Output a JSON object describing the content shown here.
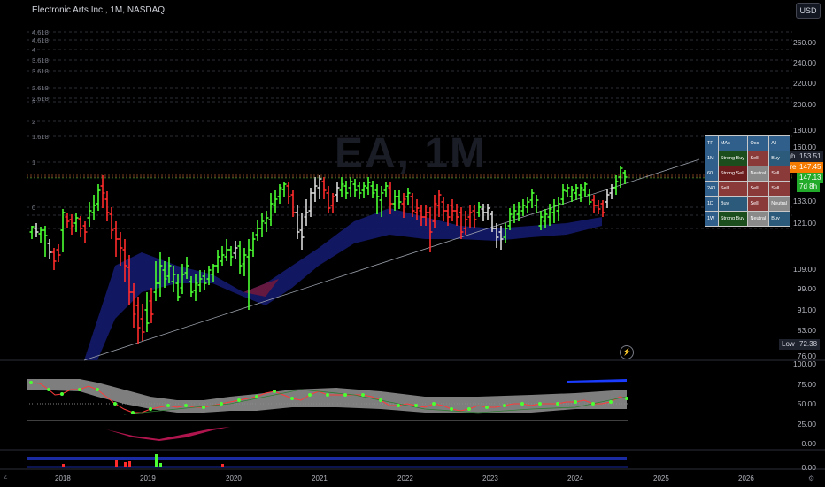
{
  "header": {
    "title": "Electronic Arts Inc., 1M, NASDAQ",
    "currency_button": "USD"
  },
  "watermark": "EA, 1M",
  "price_axis": [
    "260.00",
    "240.00",
    "220.00",
    "200.00",
    "180.00",
    "160.00",
    "147.45",
    "133.00",
    "121.00",
    "109.00",
    "99.00",
    "91.00",
    "83.00",
    "76.00"
  ],
  "osc_axis": [
    "100.00",
    "75.00",
    "50.00",
    "25.00",
    "0.00"
  ],
  "vol_axis": [
    "0.00"
  ],
  "time_axis": [
    "2018",
    "2019",
    "2020",
    "2021",
    "2022",
    "2023",
    "2024",
    "2025",
    "2026"
  ],
  "fib_labels": [
    "4.618",
    "4.618",
    "4",
    "3.618",
    "3.618",
    "2.618",
    "2.618",
    "3",
    "2",
    "1.618",
    "1",
    "0"
  ],
  "price_tags": {
    "high_label": "High",
    "high_value": "153.51",
    "pre_label": "Pre",
    "pre_value": "147.45",
    "last_value": "147.13",
    "countdown": "7d 8h",
    "low_label": "Low",
    "low_value": "72.38"
  },
  "ta_table": {
    "headers": [
      "TF",
      "MAs",
      "Osc",
      "All"
    ],
    "rows": [
      {
        "tf": "1M",
        "mas": "Strong Buy",
        "osc": "Sell",
        "all": "Buy"
      },
      {
        "tf": "60",
        "mas": "Strong Sell",
        "osc": "Neutral",
        "all": "Sell"
      },
      {
        "tf": "240",
        "mas": "Sell",
        "osc": "Sell",
        "all": "Sell"
      },
      {
        "tf": "1D",
        "mas": "Buy",
        "osc": "Sell",
        "all": "Neutral"
      },
      {
        "tf": "1W",
        "mas": "Strong Buy",
        "osc": "Neutral",
        "all": "Buy"
      }
    ]
  },
  "icons": {
    "timezone": "Z",
    "settings": "⚙",
    "bolt": "⚡"
  },
  "colors": {
    "up_bar": "#4cff33",
    "down_bar": "#ff2b2b",
    "neutral_bar": "#d9d9d9",
    "cloud": "#141a6b",
    "table_strong_buy": "#1c4d1c",
    "table_sell": "#8b3a3a",
    "table_neutral": "#8a8a8a",
    "table_buy": "#2b5a7a",
    "table_header": "#2f5f8a"
  }
}
